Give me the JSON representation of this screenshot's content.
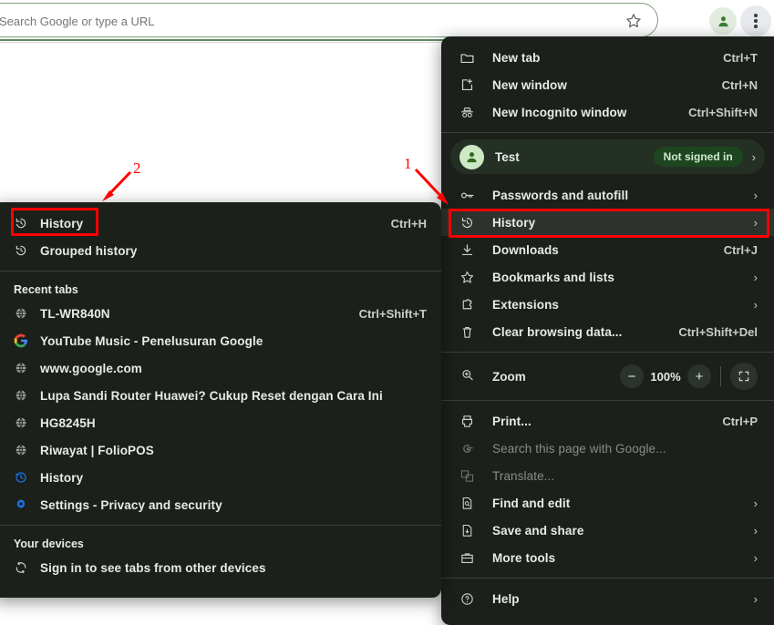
{
  "browser": {
    "omnibox_value": "",
    "omnibox_placeholder": "Search Google or type a URL",
    "star_icon": "bookmark-star-icon",
    "profile_icon": "profile-avatar-icon",
    "menu_icon": "three-dot-menu-icon"
  },
  "chrome_menu": {
    "top_items": [
      {
        "icon": "new-tab-icon",
        "label": "New tab",
        "accel": "Ctrl+T",
        "chevron": "",
        "disabled": false
      },
      {
        "icon": "new-window-icon",
        "label": "New window",
        "accel": "Ctrl+N",
        "chevron": "",
        "disabled": false
      },
      {
        "icon": "incognito-icon",
        "label": "New Incognito window",
        "accel": "Ctrl+Shift+N",
        "chevron": "",
        "disabled": false
      }
    ],
    "profile": {
      "avatar_icon": "person-avatar-icon",
      "name": "Test",
      "badge": "Not signed in",
      "chevron": "›"
    },
    "mid_items": [
      {
        "icon": "key-icon",
        "label": "Passwords and autofill",
        "accel": "",
        "chevron": "›",
        "disabled": false
      },
      {
        "icon": "history-icon",
        "label": "History",
        "accel": "",
        "chevron": "›",
        "disabled": false,
        "highlighted": true
      },
      {
        "icon": "download-icon",
        "label": "Downloads",
        "accel": "Ctrl+J",
        "chevron": "",
        "disabled": false
      },
      {
        "icon": "star-icon",
        "label": "Bookmarks and lists",
        "accel": "",
        "chevron": "›",
        "disabled": false
      },
      {
        "icon": "extension-icon",
        "label": "Extensions",
        "accel": "",
        "chevron": "›",
        "disabled": false
      },
      {
        "icon": "trash-icon",
        "label": "Clear browsing data...",
        "accel": "Ctrl+Shift+Del",
        "chevron": "",
        "disabled": false
      }
    ],
    "zoom": {
      "icon": "zoom-magnifier-icon",
      "label": "Zoom",
      "minus_label": "−",
      "value": "100%",
      "plus_label": "+",
      "fullscreen_icon": "fullscreen-icon"
    },
    "tool_items": [
      {
        "icon": "printer-icon",
        "label": "Print...",
        "accel": "Ctrl+P",
        "chevron": "",
        "disabled": false
      },
      {
        "icon": "google-g-icon",
        "label": "Search this page with Google...",
        "accel": "",
        "chevron": "",
        "disabled": true
      },
      {
        "icon": "translate-icon",
        "label": "Translate...",
        "accel": "",
        "chevron": "",
        "disabled": true
      },
      {
        "icon": "find-edit-icon",
        "label": "Find and edit",
        "accel": "",
        "chevron": "›",
        "disabled": false
      },
      {
        "icon": "save-share-icon",
        "label": "Save and share",
        "accel": "",
        "chevron": "›",
        "disabled": false
      },
      {
        "icon": "toolbox-icon",
        "label": "More tools",
        "accel": "",
        "chevron": "›",
        "disabled": false
      }
    ],
    "help_item": {
      "icon": "help-circle-icon",
      "label": "Help",
      "accel": "",
      "chevron": "›",
      "disabled": false
    }
  },
  "history_menu": {
    "top_items": [
      {
        "icon": "history-icon",
        "label": "History",
        "accel": "Ctrl+H",
        "highlighted": true
      },
      {
        "icon": "grouped-history-icon",
        "label": "Grouped history",
        "accel": "",
        "highlighted": false
      }
    ],
    "recent_tabs_heading": "Recent tabs",
    "recent_tabs": [
      {
        "favicon": "globe-icon",
        "label": "TL-WR840N",
        "accel": "Ctrl+Shift+T"
      },
      {
        "favicon": "google-g-icon",
        "label": "YouTube Music - Penelusuran Google",
        "accel": ""
      },
      {
        "favicon": "globe-icon",
        "label": "www.google.com",
        "accel": ""
      },
      {
        "favicon": "globe-icon",
        "label": "Lupa Sandi Router Huawei? Cukup Reset dengan Cara Ini",
        "accel": ""
      },
      {
        "favicon": "globe-icon",
        "label": "HG8245H",
        "accel": ""
      },
      {
        "favicon": "globe-icon",
        "label": "Riwayat | FolioPOS",
        "accel": ""
      },
      {
        "favicon": "history-blue-icon",
        "label": "History",
        "accel": ""
      },
      {
        "favicon": "settings-blue-icon",
        "label": "Settings - Privacy and security",
        "accel": ""
      }
    ],
    "your_devices_heading": "Your devices",
    "sign_in_item": {
      "favicon": "sync-icon",
      "label": "Sign in to see tabs from other devices",
      "accel": ""
    }
  },
  "annotations": {
    "marker_one": "1",
    "marker_two": "2",
    "highlight_color": "#ff0000"
  }
}
